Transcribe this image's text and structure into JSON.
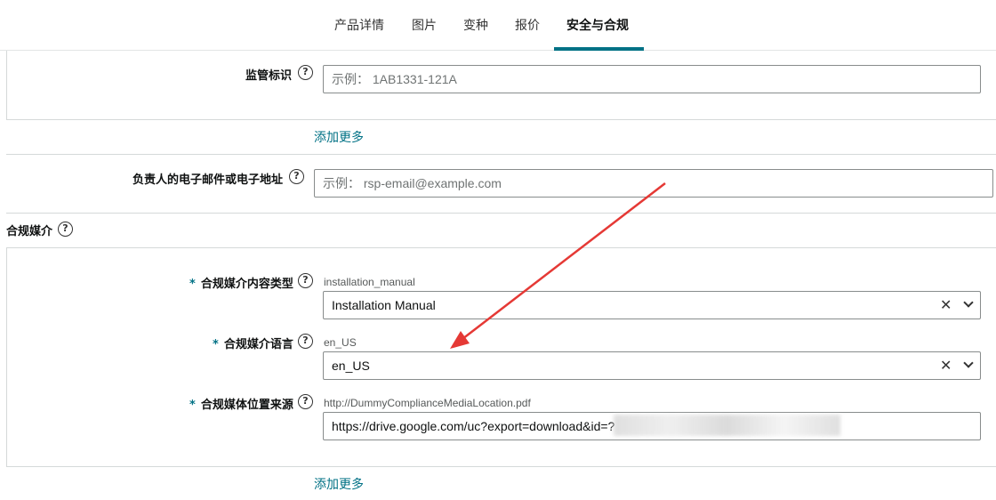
{
  "tabs": [
    {
      "label": "产品详情"
    },
    {
      "label": "图片"
    },
    {
      "label": "变种"
    },
    {
      "label": "报价"
    },
    {
      "label": "安全与合规"
    }
  ],
  "regulatory_id": {
    "label": "监管标识",
    "placeholder": "示例： 1AB1331-121A"
  },
  "add_more_1": "添加更多",
  "responsible_email": {
    "label": "负责人的电子邮件或电子地址",
    "placeholder": "示例： rsp-email@example.com"
  },
  "compliance_media": {
    "title": "合规媒介",
    "content_type": {
      "required": "*",
      "label": "合规媒介内容类型",
      "hint": "installation_manual",
      "value": "Installation Manual"
    },
    "language": {
      "required": "*",
      "label": "合规媒介语言",
      "hint": "en_US",
      "value": "en_US"
    },
    "source_location": {
      "required": "*",
      "label": "合规媒体位置来源",
      "hint": "http://DummyComplianceMediaLocation.pdf",
      "value": "https://drive.google.com/uc?export=download&id=?"
    }
  },
  "add_more_2": "添加更多",
  "icons": {
    "help": "?",
    "clear": "✕"
  },
  "colors": {
    "accent": "#007185",
    "annotation_arrow": "#e53935"
  }
}
